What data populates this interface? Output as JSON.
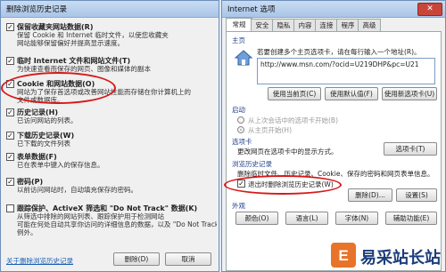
{
  "left": {
    "title": "删除浏览历史记录",
    "options": [
      {
        "checked": true,
        "title": "保留收藏夹网站数据(R)",
        "desc": [
          "保留 Cookie 和 Internet 临时文件，以使您收藏夹",
          "网站能够保留偏好并提高显示速度。"
        ]
      },
      {
        "checked": true,
        "title": "临时 Internet 文件和网站文件(T)",
        "desc": [
          "为快速查看而保存的网页、图像和媒体的副本"
        ]
      },
      {
        "checked": true,
        "title": "Cookie 和网站数据(O)",
        "desc": [
          "网站为了保存首选项或改善网站性能而存储在你计算机上的",
          "文件或数据库。"
        ]
      },
      {
        "checked": true,
        "title": "历史记录(H)",
        "desc": [
          "已访问网站的列表。"
        ]
      },
      {
        "checked": true,
        "title": "下载历史记录(W)",
        "desc": [
          "已下载的文件列表"
        ]
      },
      {
        "checked": true,
        "title": "表单数据(F)",
        "desc": [
          "已在表单中键入的保存信息。"
        ]
      },
      {
        "checked": true,
        "title": "密码(P)",
        "desc": [
          "以前访问网站时，自动填充保存的密码。"
        ]
      },
      {
        "checked": false,
        "title": "跟踪保护、ActiveX 筛选和 \"Do Not Track\" 数据(K)",
        "desc": [
          "从筛选中排除的网站列表、跟踪保护用于检测网站",
          "可能在何处自动共享你访问的详细信息的数据，以及 \"Do Not Track\" 请求的",
          "例外。"
        ]
      }
    ],
    "link": "关于删除浏览历史记录",
    "delete_label": "删除(D)",
    "cancel_label": "取消"
  },
  "right": {
    "title": "Internet 选项",
    "close": "✕",
    "tabs": [
      "常规",
      "安全",
      "隐私",
      "内容",
      "连接",
      "程序",
      "高级"
    ],
    "home": {
      "section": "主页",
      "hint": "若要创建多个主页选项卡，请在每行输入一个地址(R)。",
      "url": "http://www.msn.com/?ocid=U219DHP&pc=U21",
      "btn_current": "使用当前页(C)",
      "btn_default": "使用默认值(F)",
      "btn_new_tab": "使用新选项卡(U)"
    },
    "startup": {
      "section": "启动",
      "opt1": "从上次会话中的选项卡开始(B)",
      "opt2": "从主页开始(H)"
    },
    "tabsect": {
      "section": "选项卡",
      "text": "更改网页在选项卡中的显示方式。",
      "btn": "选项卡(T)"
    },
    "history": {
      "section": "浏览历史记录",
      "text": "删除临时文件、历史记录、Cookie、保存的密码和网页表单信息。",
      "check_label": "退出时删除浏览历史记录(W)",
      "btn_delete": "删除(D)...",
      "btn_settings": "设置(S)"
    },
    "appearance": {
      "section": "外观",
      "btn_colors": "颜色(O)",
      "btn_languages": "语言(L)",
      "btn_fonts": "字体(N)",
      "btn_access": "辅助功能(E)"
    }
  },
  "watermark": {
    "brand": "易采站长站",
    "initial": "E"
  }
}
